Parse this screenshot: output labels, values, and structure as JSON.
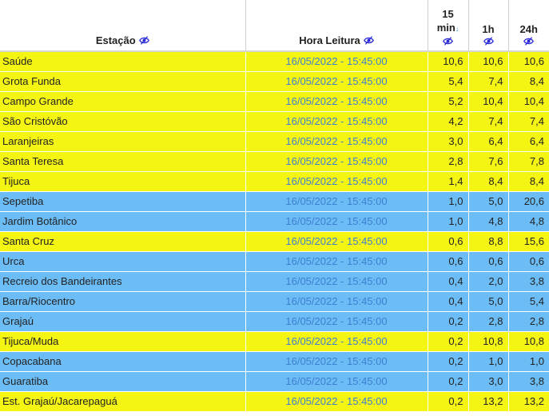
{
  "header": {
    "station": "Estação",
    "time": "Hora Leitura",
    "min15_top": "15",
    "min15_bottom": "min",
    "h1": "1h",
    "h24": "24h"
  },
  "colors": {
    "yellow": "#f5f513",
    "blue": "#6cbcf6",
    "time_text": "#3e7fd0",
    "icon": "#2b2bd6"
  },
  "rows": [
    {
      "station": "Saúde",
      "time": "16/05/2022 - 15:45:00",
      "m15": "10,6",
      "h1": "10,6",
      "h24": "10,6",
      "color": "yellow"
    },
    {
      "station": "Grota Funda",
      "time": "16/05/2022 - 15:45:00",
      "m15": "5,4",
      "h1": "7,4",
      "h24": "8,4",
      "color": "yellow"
    },
    {
      "station": "Campo Grande",
      "time": "16/05/2022 - 15:45:00",
      "m15": "5,2",
      "h1": "10,4",
      "h24": "10,4",
      "color": "yellow"
    },
    {
      "station": "São Cristóvão",
      "time": "16/05/2022 - 15:45:00",
      "m15": "4,2",
      "h1": "7,4",
      "h24": "7,4",
      "color": "yellow"
    },
    {
      "station": "Laranjeiras",
      "time": "16/05/2022 - 15:45:00",
      "m15": "3,0",
      "h1": "6,4",
      "h24": "6,4",
      "color": "yellow"
    },
    {
      "station": "Santa Teresa",
      "time": "16/05/2022 - 15:45:00",
      "m15": "2,8",
      "h1": "7,6",
      "h24": "7,8",
      "color": "yellow"
    },
    {
      "station": "Tijuca",
      "time": "16/05/2022 - 15:45:00",
      "m15": "1,4",
      "h1": "8,4",
      "h24": "8,4",
      "color": "yellow"
    },
    {
      "station": "Sepetiba",
      "time": "16/05/2022 - 15:45:00",
      "m15": "1,0",
      "h1": "5,0",
      "h24": "20,6",
      "color": "blue"
    },
    {
      "station": "Jardim Botânico",
      "time": "16/05/2022 - 15:45:00",
      "m15": "1,0",
      "h1": "4,8",
      "h24": "4,8",
      "color": "blue"
    },
    {
      "station": "Santa Cruz",
      "time": "16/05/2022 - 15:45:00",
      "m15": "0,6",
      "h1": "8,8",
      "h24": "15,6",
      "color": "yellow"
    },
    {
      "station": "Urca",
      "time": "16/05/2022 - 15:45:00",
      "m15": "0,6",
      "h1": "0,6",
      "h24": "0,6",
      "color": "blue"
    },
    {
      "station": "Recreio dos Bandeirantes",
      "time": "16/05/2022 - 15:45:00",
      "m15": "0,4",
      "h1": "2,0",
      "h24": "3,8",
      "color": "blue"
    },
    {
      "station": "Barra/Riocentro",
      "time": "16/05/2022 - 15:45:00",
      "m15": "0,4",
      "h1": "5,0",
      "h24": "5,4",
      "color": "blue"
    },
    {
      "station": "Grajaú",
      "time": "16/05/2022 - 15:45:00",
      "m15": "0,2",
      "h1": "2,8",
      "h24": "2,8",
      "color": "blue"
    },
    {
      "station": "Tijuca/Muda",
      "time": "16/05/2022 - 15:45:00",
      "m15": "0,2",
      "h1": "10,8",
      "h24": "10,8",
      "color": "yellow"
    },
    {
      "station": "Copacabana",
      "time": "16/05/2022 - 15:45:00",
      "m15": "0,2",
      "h1": "1,0",
      "h24": "1,0",
      "color": "blue"
    },
    {
      "station": "Guaratiba",
      "time": "16/05/2022 - 15:45:00",
      "m15": "0,2",
      "h1": "3,0",
      "h24": "3,8",
      "color": "blue"
    },
    {
      "station": "Est. Grajaú/Jacarepaguá",
      "time": "16/05/2022 - 15:45:00",
      "m15": "0,2",
      "h1": "13,2",
      "h24": "13,2",
      "color": "yellow"
    }
  ]
}
